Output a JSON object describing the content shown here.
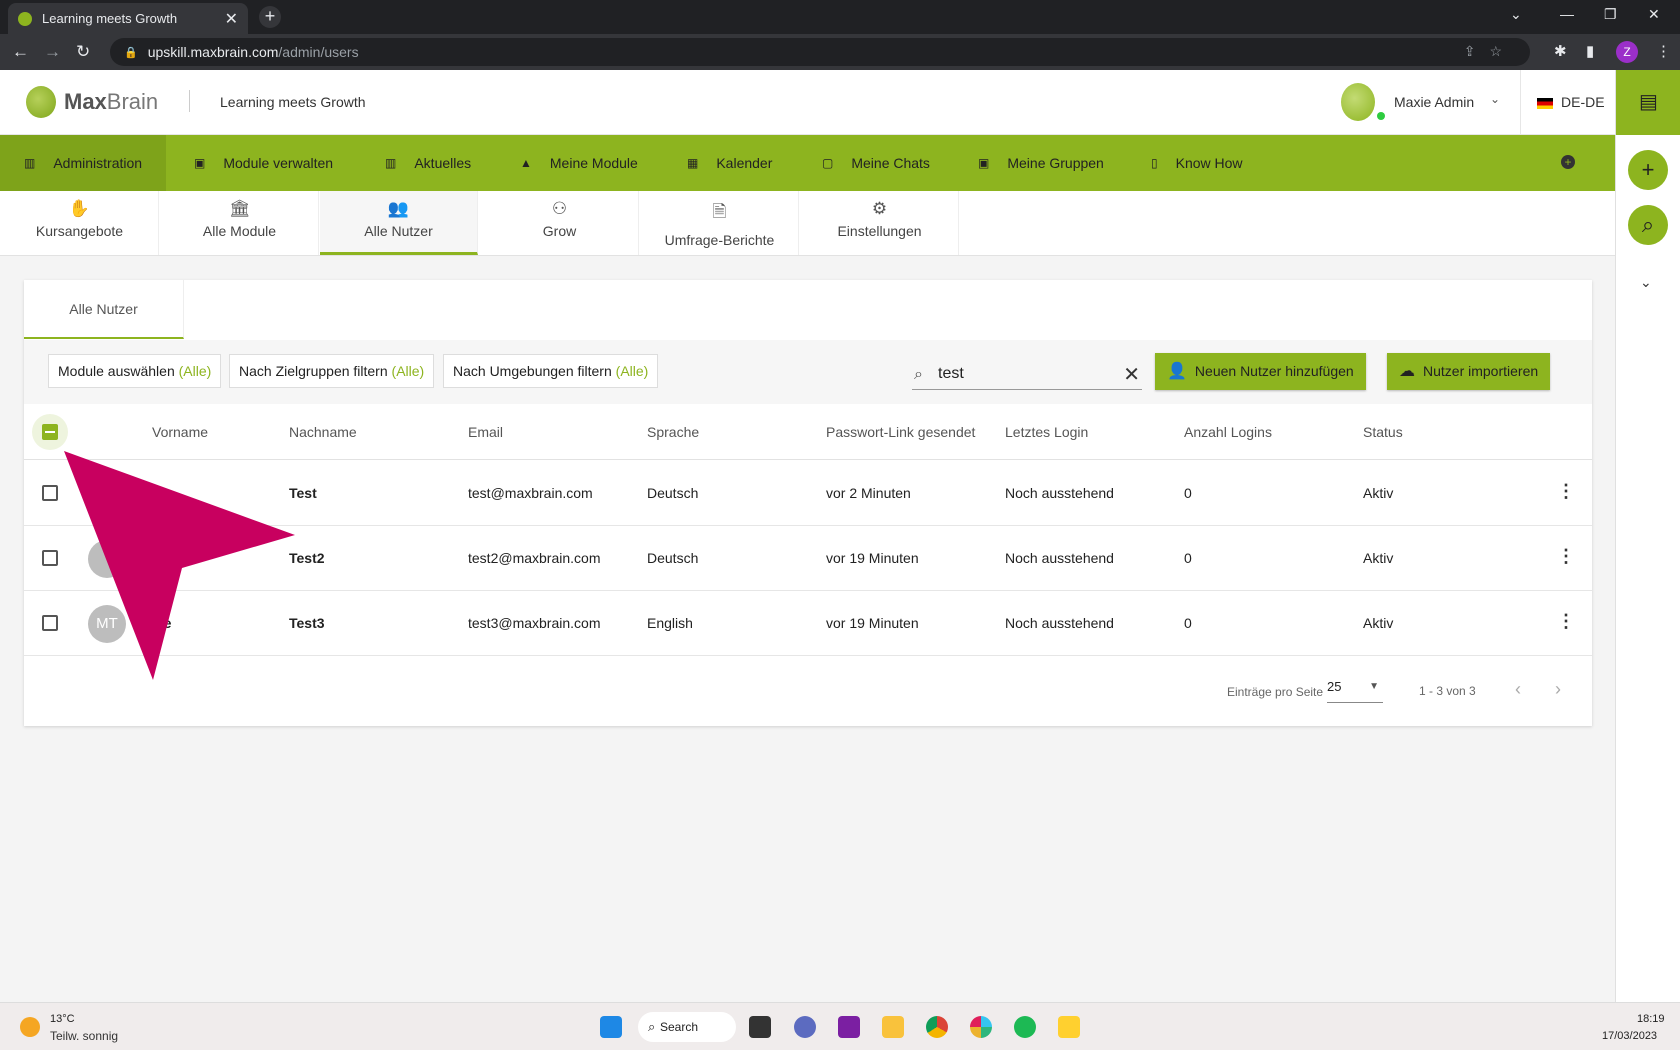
{
  "browser": {
    "tab_title": "Learning meets Growth",
    "url_host": "upskill.maxbrain.com",
    "url_path": "/admin/users",
    "profile_initial": "Z"
  },
  "header": {
    "brand_max": "Max",
    "brand_brain": "Brain",
    "tagline": "Learning meets Growth",
    "user_name": "Maxie Admin",
    "language": "DE-DE"
  },
  "main_nav": [
    {
      "label": "Administration",
      "icon": "admin-icon"
    },
    {
      "label": "Module verwalten",
      "icon": "module-manage-icon"
    },
    {
      "label": "Aktuelles",
      "icon": "news-icon"
    },
    {
      "label": "Meine Module",
      "icon": "graduation-cap-icon"
    },
    {
      "label": "Kalender",
      "icon": "calendar-icon"
    },
    {
      "label": "Meine Chats",
      "icon": "chat-icon"
    },
    {
      "label": "Meine Gruppen",
      "icon": "groups-icon"
    },
    {
      "label": "Know How",
      "icon": "book-icon"
    }
  ],
  "sub_tabs": [
    {
      "label": "Kursangebote",
      "icon": "course-offer-icon"
    },
    {
      "label": "Alle Module",
      "icon": "institution-icon"
    },
    {
      "label": "Alle Nutzer",
      "icon": "users-icon"
    },
    {
      "label": "Grow",
      "icon": "group-icon"
    },
    {
      "label": "Umfrage-Berichte",
      "icon": "report-icon"
    },
    {
      "label": "Einstellungen",
      "icon": "settings-icon"
    }
  ],
  "card": {
    "tab_label": "Alle Nutzer",
    "filters": [
      {
        "label": "Module auswählen",
        "suffix": "(Alle)"
      },
      {
        "label": "Nach Zielgruppen filtern",
        "suffix": "(Alle)"
      },
      {
        "label": "Nach Umgebungen filtern",
        "suffix": "(Alle)"
      }
    ],
    "search_value": "test",
    "add_user_label": "Neuen Nutzer hinzufügen",
    "import_label": "Nutzer importieren"
  },
  "table": {
    "columns": [
      "Vorname",
      "Nachname",
      "Email",
      "Sprache",
      "Passwort-Link gesendet",
      "Letztes Login",
      "Anzahl Logins",
      "Status"
    ],
    "rows": [
      {
        "avatar": "",
        "vorname": "",
        "nachname": "Test",
        "email": "test@maxbrain.com",
        "sprache": "Deutsch",
        "passwort": "vor 2 Minuten",
        "login": "Noch ausstehend",
        "anzahl": "0",
        "status": "Aktiv"
      },
      {
        "avatar": "",
        "vorname": "",
        "nachname": "Test2",
        "email": "test2@maxbrain.com",
        "sprache": "Deutsch",
        "passwort": "vor 19 Minuten",
        "login": "Noch ausstehend",
        "anzahl": "0",
        "status": "Aktiv"
      },
      {
        "avatar": "MT",
        "vorname": "xie",
        "nachname": "Test3",
        "email": "test3@maxbrain.com",
        "sprache": "English",
        "passwort": "vor 19 Minuten",
        "login": "Noch ausstehend",
        "anzahl": "0",
        "status": "Aktiv"
      }
    ]
  },
  "pagination": {
    "per_page_label": "Einträge pro Seite",
    "per_page_value": "25",
    "range": "1 - 3 von 3"
  },
  "taskbar": {
    "temperature": "13°C",
    "weather": "Teilw. sonnig",
    "search_label": "Search",
    "time": "18:19",
    "date": "17/03/2023"
  },
  "colors": {
    "brand_green": "#8db41f",
    "pointer_magenta": "#c8005f"
  }
}
